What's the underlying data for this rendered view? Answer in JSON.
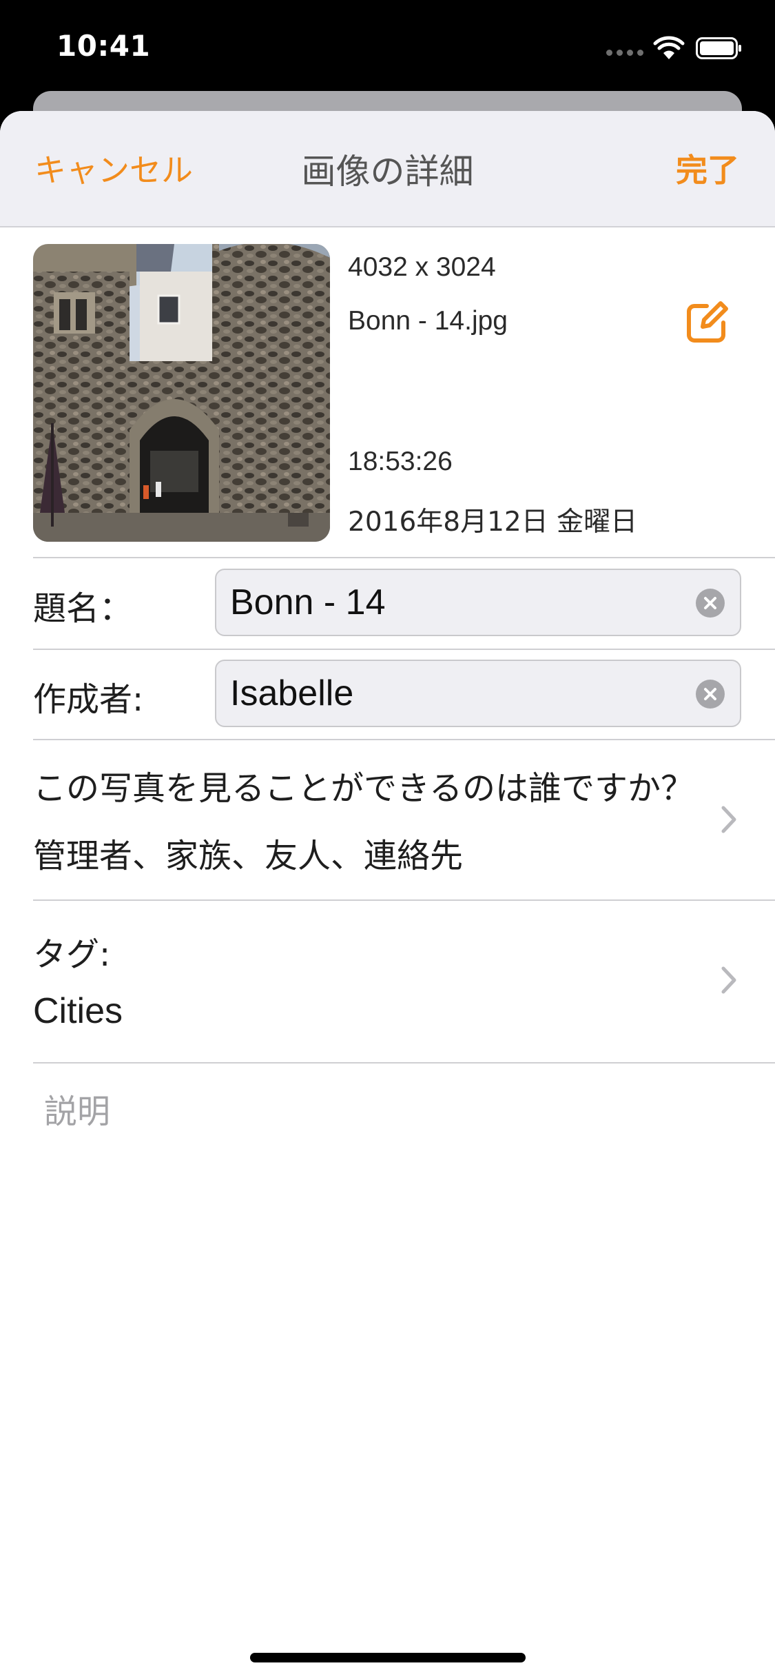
{
  "status_bar": {
    "time": "10:41"
  },
  "nav": {
    "cancel_label": "キャンセル",
    "title": "画像の詳細",
    "done_label": "完了"
  },
  "image_info": {
    "dimensions": "4032 x 3024",
    "filename": "Bonn - 14.jpg",
    "time": "18:53:26",
    "date": "2016年8月12日 金曜日"
  },
  "form": {
    "title_label": "題名：",
    "title_value": "Bonn - 14",
    "author_label": "作成者:",
    "author_value": "Isabelle",
    "visibility_question": "この写真を見ることができるのは誰ですか？",
    "visibility_value": "管理者、家族、友人、連絡先",
    "tags_label": "タグ:",
    "tags_value": "Cities",
    "description_placeholder": "説明"
  },
  "icons": {
    "edit": "edit-square-pencil-icon",
    "clear": "clear-circle-x-icon",
    "chevron": "chevron-right-icon",
    "wifi": "wifi-icon",
    "battery": "battery-icon"
  },
  "colors": {
    "accent": "#f28c1c",
    "nav_background": "#efeff4",
    "field_background": "#efeff3"
  }
}
